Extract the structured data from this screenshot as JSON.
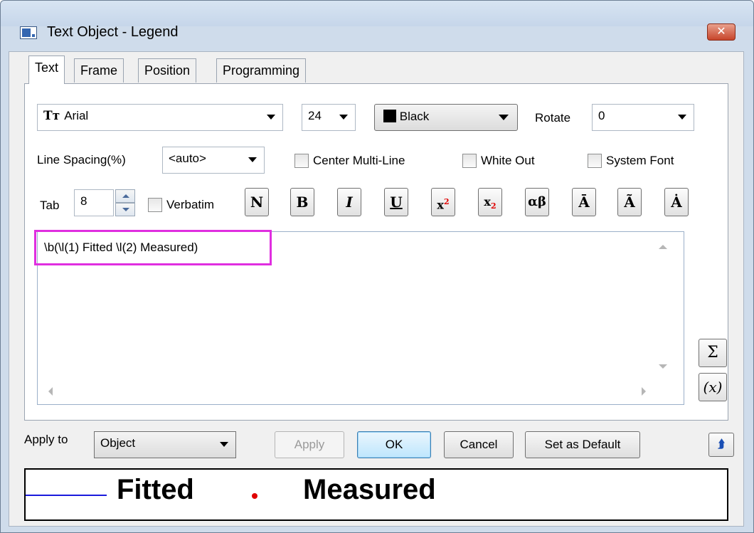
{
  "window": {
    "title": "Text Object - Legend",
    "close_label": "✕"
  },
  "tabs": [
    {
      "label": "Text"
    },
    {
      "label": "Frame"
    },
    {
      "label": "Position"
    },
    {
      "label": "Programming"
    }
  ],
  "font": {
    "name": "Arial",
    "size": "24",
    "color": "Black"
  },
  "rotate": {
    "label": "Rotate",
    "value": "0"
  },
  "line_spacing": {
    "label": "Line Spacing(%)",
    "value": "<auto>"
  },
  "options": {
    "center_multiline": "Center Multi-Line",
    "white_out": "White Out",
    "system_font": "System Font",
    "verbatim": "Verbatim"
  },
  "tab": {
    "label": "Tab",
    "value": "8"
  },
  "format_buttons": [
    "N",
    "B",
    "I",
    "U",
    "x2",
    "x2",
    "αβ",
    "Ā",
    "Ã",
    "Ȧ"
  ],
  "editor": {
    "text": "\\b(\\l(1) Fitted \\l(2) Measured)"
  },
  "side_buttons": {
    "sigma": "Σ",
    "function": "(x)"
  },
  "apply_to": {
    "label": "Apply to",
    "value": "Object"
  },
  "buttons": {
    "apply": "Apply",
    "ok": "OK",
    "cancel": "Cancel",
    "set_default": "Set as Default"
  },
  "preview": {
    "item1": "Fitted",
    "item2": "Measured",
    "line_color": "#1a1adc",
    "dot_color": "#e00000"
  },
  "colors": {
    "highlight": "#e02ee0"
  }
}
